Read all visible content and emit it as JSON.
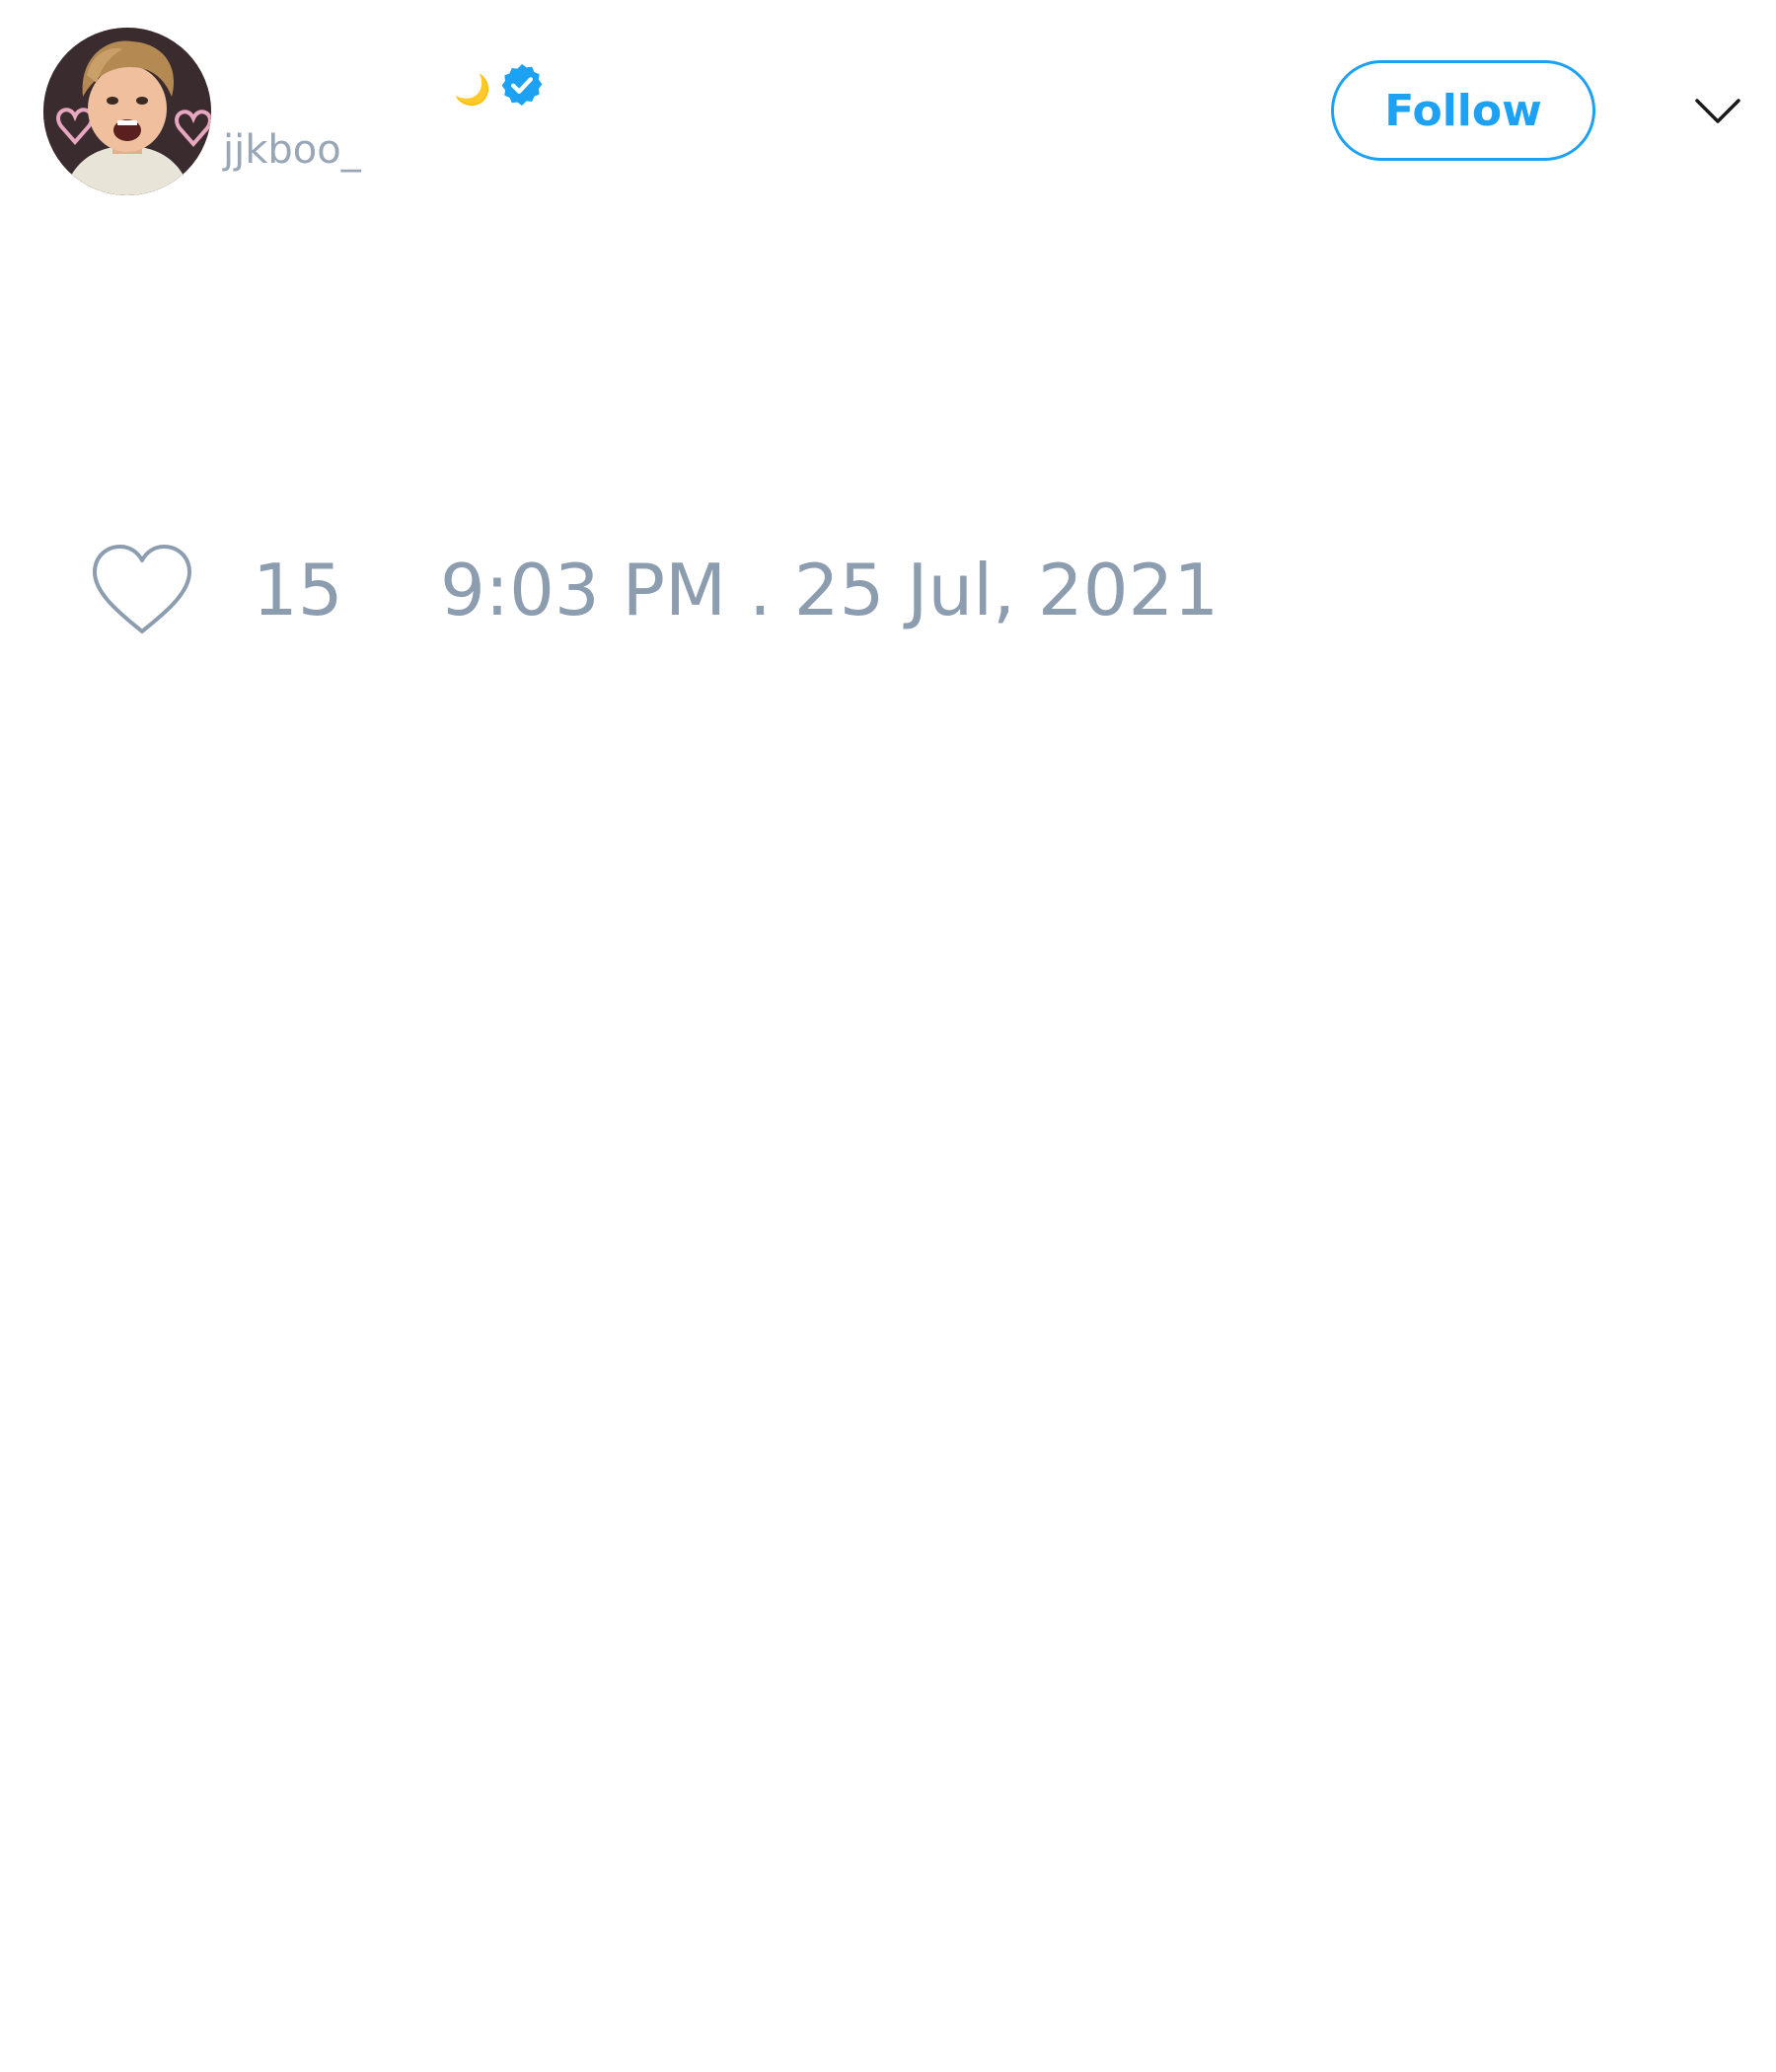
{
  "tweet": {
    "author": {
      "display_name_emoji": "🌙",
      "handle": "jjkboo_",
      "verified": true
    },
    "follow_button_label": "Follow",
    "like_count": "15",
    "timestamp": "9:03 PM . 25 Jul, 2021"
  },
  "colors": {
    "accent": "#1da1f2",
    "muted_text": "#8d9db0",
    "handle_text": "#98a6b6",
    "background": "#ffffff"
  },
  "icons": {
    "verified": "verified-badge-icon",
    "menu": "chevron-down-icon",
    "like": "heart-icon"
  }
}
